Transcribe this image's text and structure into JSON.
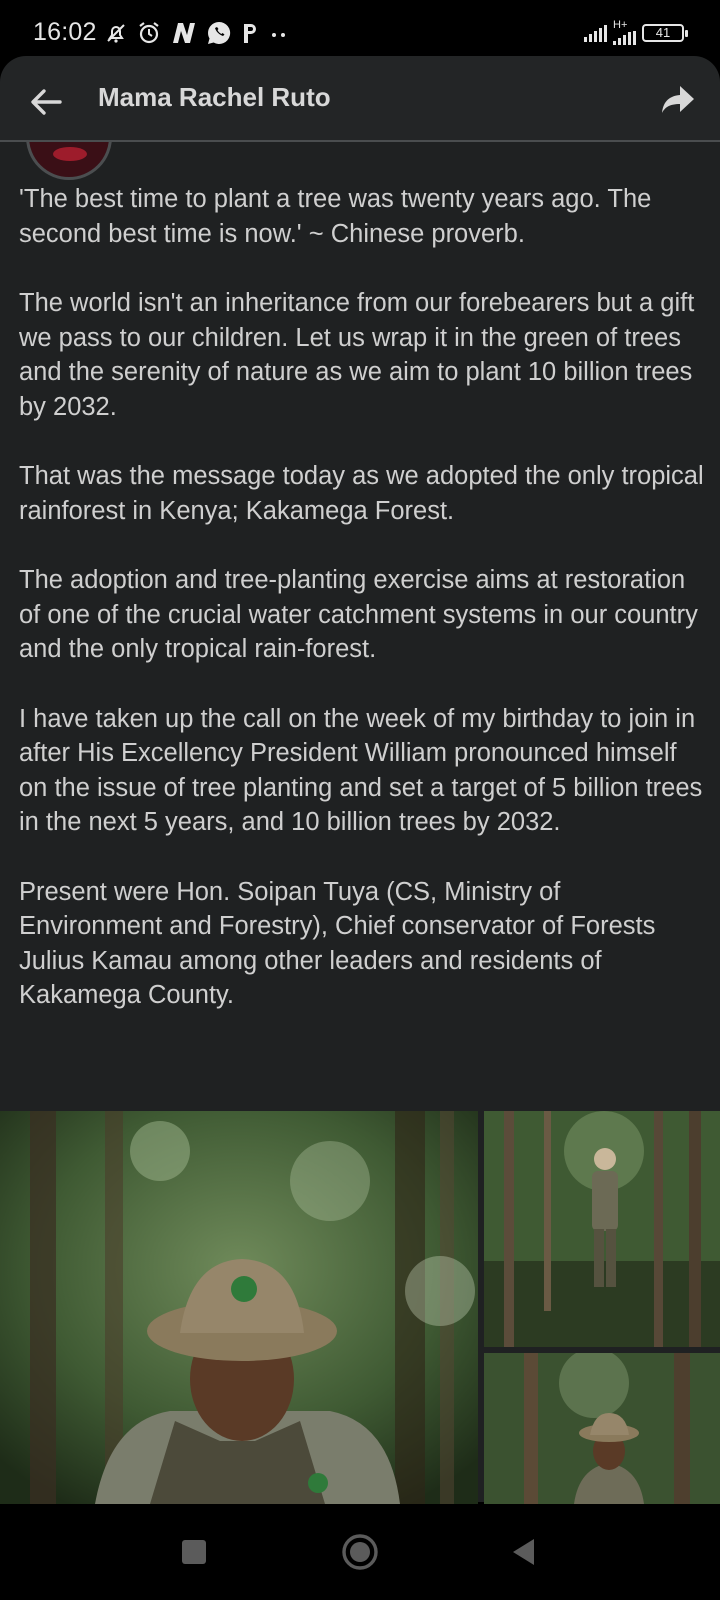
{
  "status_bar": {
    "time": "16:02",
    "notification_icons": [
      "mute-bell-icon",
      "alarm-icon",
      "n-app-icon",
      "whatsapp-icon",
      "p-app-icon",
      "more-dots-icon"
    ],
    "network_label": "H+",
    "battery": "41"
  },
  "app_bar": {
    "title": "Mama Rachel Ruto"
  },
  "post": {
    "paragraphs": [
      "'The best time to plant a tree was twenty years ago. The second best time is now.' ~ Chinese proverb.",
      "The world isn't an inheritance from our forebearers but a gift we pass to our children. Let us wrap it in the green of trees and the serenity of nature as we aim to plant 10 billion trees by 2032.",
      "That was the message today as we adopted the only tropical rainforest in Kenya; Kakamega Forest.",
      "The adoption and tree-planting exercise aims at restoration of one of the crucial water catchment systems in our country and the only tropical rain-forest.",
      "I have taken up the call on the week of my birthday to join in after His Excellency President William pronounced himself on the issue of tree planting and set a target of 5 billion trees in the next 5 years, and 10 billion trees by 2032.",
      "Present were Hon. Soipan Tuya (CS, Ministry of Environment and Forestry), Chief conservator of Forests Julius Kamau among other leaders and residents of Kakamega County."
    ]
  },
  "colors": {
    "background": "#1f2122",
    "app_bar": "#232526",
    "text": "#cfcfcf",
    "forest_green": "#3f5a33",
    "uniform_khaki": "#8a7a5c"
  },
  "nav_bar": {
    "icons": [
      "recents-square-icon",
      "home-circle-icon",
      "back-triangle-icon"
    ]
  }
}
